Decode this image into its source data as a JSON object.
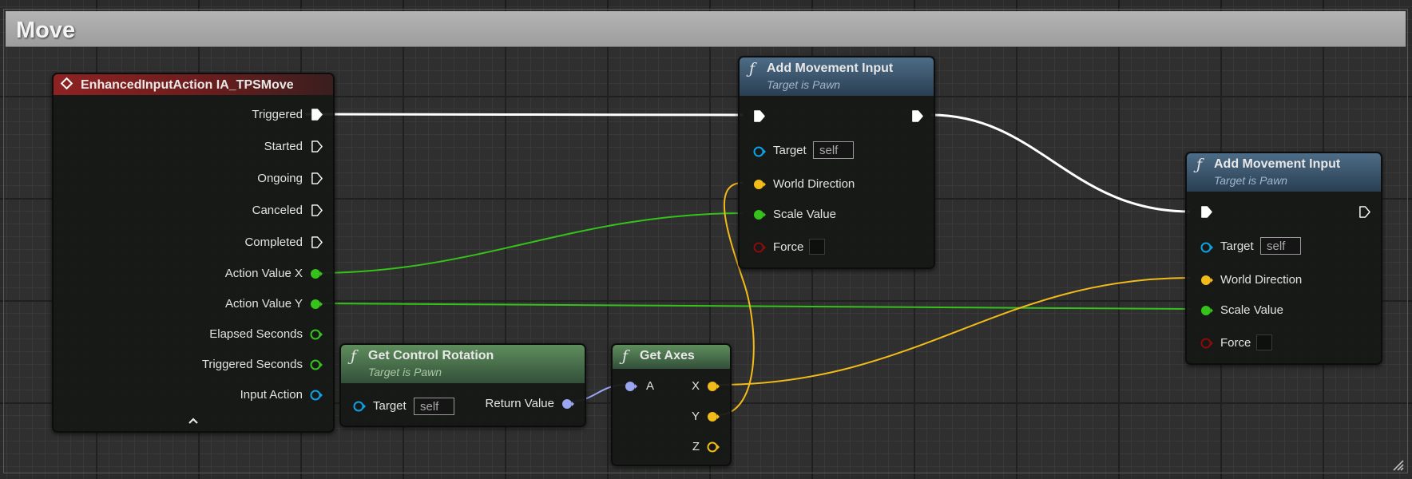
{
  "comment": {
    "title": "Move"
  },
  "nodes": {
    "input_action": {
      "title": "EnhancedInputAction IA_TPSMove",
      "pins": {
        "triggered": "Triggered",
        "started": "Started",
        "ongoing": "Ongoing",
        "canceled": "Canceled",
        "completed": "Completed",
        "action_value_x": "Action Value X",
        "action_value_y": "Action Value Y",
        "elapsed_seconds": "Elapsed Seconds",
        "triggered_seconds": "Triggered Seconds",
        "input_action": "Input Action"
      }
    },
    "get_control_rotation": {
      "title": "Get Control Rotation",
      "subtitle": "Target is Pawn",
      "target_label": "Target",
      "target_value": "self",
      "return_label": "Return Value"
    },
    "get_axes": {
      "title": "Get Axes",
      "a_label": "A",
      "x_label": "X",
      "y_label": "Y",
      "z_label": "Z"
    },
    "add_movement_1": {
      "title": "Add Movement Input",
      "subtitle": "Target is Pawn",
      "target_label": "Target",
      "target_value": "self",
      "world_direction_label": "World Direction",
      "scale_value_label": "Scale Value",
      "force_label": "Force"
    },
    "add_movement_2": {
      "title": "Add Movement Input",
      "subtitle": "Target is Pawn",
      "target_label": "Target",
      "target_value": "self",
      "world_direction_label": "World Direction",
      "scale_value_label": "Scale Value",
      "force_label": "Force"
    }
  },
  "colors": {
    "exec": "#ffffff",
    "float": "#35c21a",
    "vector": "#f1bb1a",
    "object": "#0ea1e4",
    "rotator": "#9aa6f0",
    "bool": "#8a0b0b",
    "header_event": "#8e2222",
    "header_function": "#4d6c87",
    "header_pure": "#5e8d5c"
  }
}
